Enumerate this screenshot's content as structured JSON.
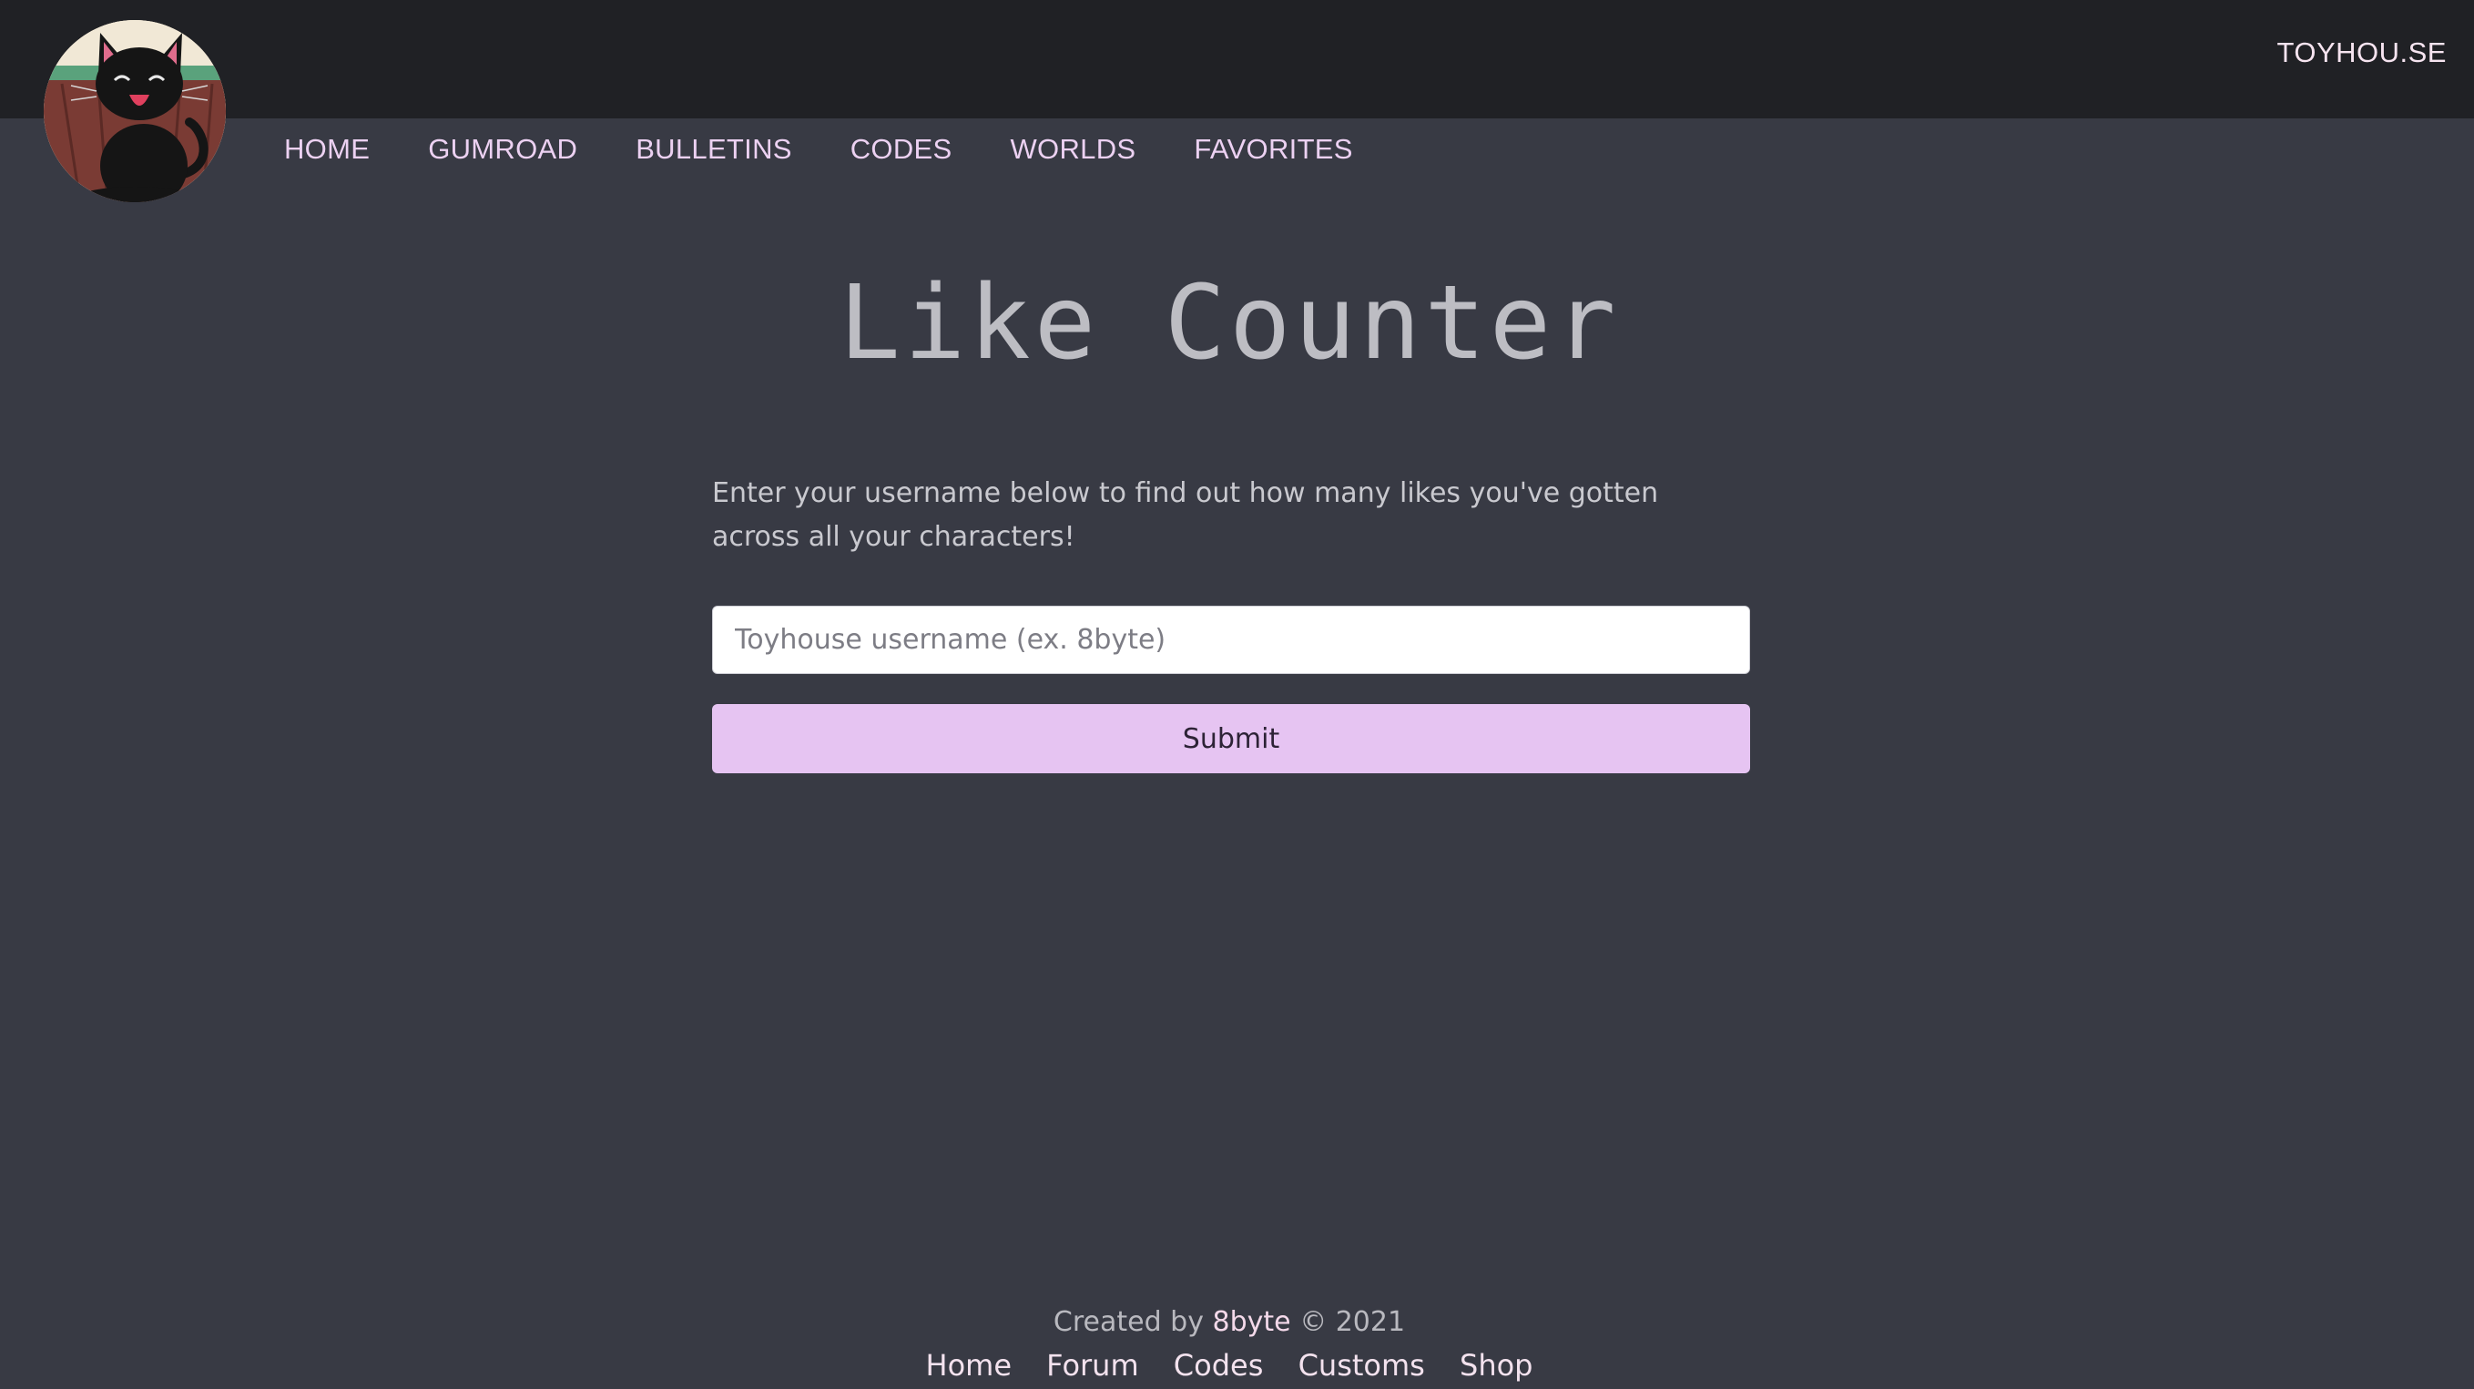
{
  "header": {
    "site_link": "TOYHOU.SE"
  },
  "avatar": {
    "icon": "black-cat-avatar-icon"
  },
  "nav": {
    "items": [
      {
        "label": "HOME"
      },
      {
        "label": "GUMROAD"
      },
      {
        "label": "BULLETINS"
      },
      {
        "label": "CODES"
      },
      {
        "label": "WORLDS"
      },
      {
        "label": "FAVORITES"
      }
    ]
  },
  "main": {
    "title": "Like Counter",
    "intro": "Enter your username below to find out how many likes you've gotten across all your characters!",
    "input": {
      "value": "",
      "placeholder": "Toyhouse username (ex. 8byte)"
    },
    "submit_label": "Submit"
  },
  "footer": {
    "credit_prefix": "Created by",
    "credit_author": "8byte",
    "credit_suffix": "© 2021",
    "links": [
      {
        "label": "Home"
      },
      {
        "label": "Forum"
      },
      {
        "label": "Codes"
      },
      {
        "label": "Customs"
      },
      {
        "label": "Shop"
      }
    ]
  },
  "colors": {
    "background": "#383a44",
    "topbar": "#202125",
    "accent": "#e6c4f2",
    "nav_text": "#ecd1f2"
  }
}
